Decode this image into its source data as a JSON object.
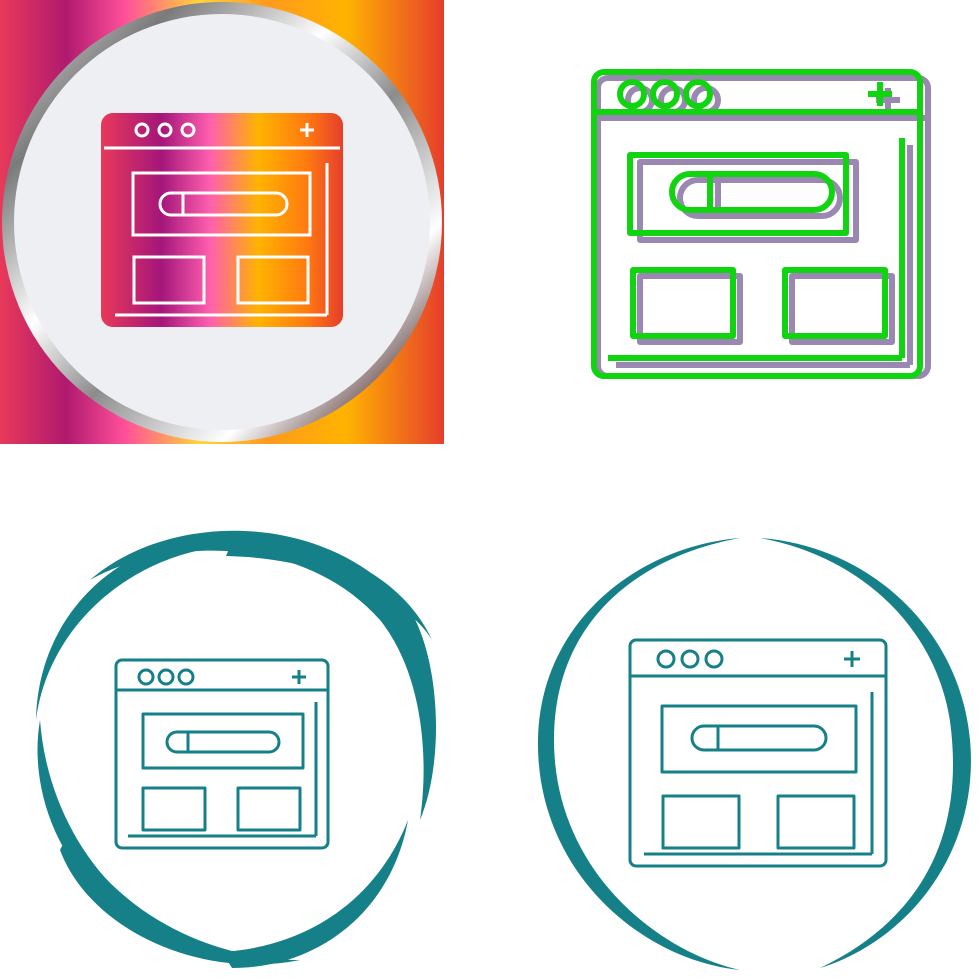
{
  "icons": [
    {
      "name": "browser-window-icon",
      "style": "gradient",
      "background": "gradient-square-with-silver-ring",
      "colors": [
        "#e8395a",
        "#a4167a",
        "#ff5fae",
        "#ffc400",
        "#e63e2c"
      ]
    },
    {
      "name": "browser-window-icon",
      "style": "outline-offset",
      "colors": [
        "#11d411",
        "#9a88b2"
      ]
    },
    {
      "name": "browser-window-icon",
      "style": "outline-with-swirl-ring",
      "colors": [
        "#168088"
      ]
    },
    {
      "name": "browser-window-icon",
      "style": "outline-with-arc-ring",
      "colors": [
        "#168088"
      ]
    }
  ]
}
